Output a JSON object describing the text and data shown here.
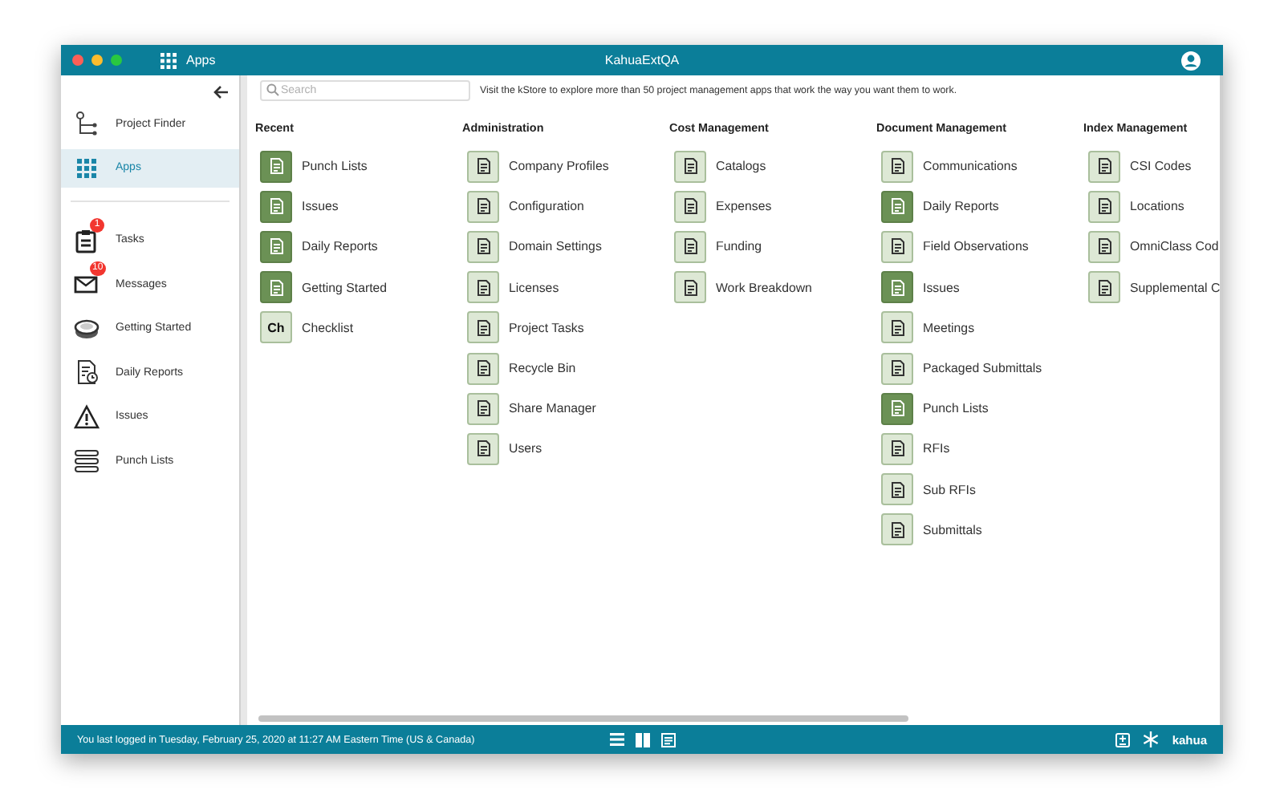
{
  "window": {
    "title": "KahuaExtQA",
    "app_label": "Apps"
  },
  "sidebar": {
    "items": [
      {
        "label": "Project Finder",
        "selected": false
      },
      {
        "label": "Apps",
        "selected": true
      },
      {
        "label": "Tasks",
        "selected": false,
        "badge": "1"
      },
      {
        "label": "Messages",
        "selected": false,
        "badge": "10"
      },
      {
        "label": "Getting Started",
        "selected": false
      },
      {
        "label": "Daily Reports",
        "selected": false
      },
      {
        "label": "Issues",
        "selected": false
      },
      {
        "label": "Punch Lists",
        "selected": false
      }
    ]
  },
  "search": {
    "placeholder": "Search"
  },
  "notice": "Visit the kStore to explore more than 50 project management apps that work the way you want them to work.",
  "groups": [
    {
      "title": "Recent",
      "apps": [
        {
          "label": "Punch Lists",
          "highlighted": true
        },
        {
          "label": "Issues",
          "highlighted": true
        },
        {
          "label": "Daily Reports",
          "highlighted": true
        },
        {
          "label": "Getting Started",
          "highlighted": true
        },
        {
          "label": "Checklist",
          "highlighted": false,
          "tile_text": "Ch"
        }
      ]
    },
    {
      "title": "Administration",
      "apps": [
        {
          "label": "Company Profiles",
          "highlighted": false
        },
        {
          "label": "Configuration",
          "highlighted": false
        },
        {
          "label": "Domain Settings",
          "highlighted": false
        },
        {
          "label": "Licenses",
          "highlighted": false
        },
        {
          "label": "Project Tasks",
          "highlighted": false
        },
        {
          "label": "Recycle Bin",
          "highlighted": false
        },
        {
          "label": "Share Manager",
          "highlighted": false
        },
        {
          "label": "Users",
          "highlighted": false
        }
      ]
    },
    {
      "title": "Cost Management",
      "apps": [
        {
          "label": "Catalogs",
          "highlighted": false
        },
        {
          "label": "Expenses",
          "highlighted": false
        },
        {
          "label": "Funding",
          "highlighted": false
        },
        {
          "label": "Work Breakdown",
          "highlighted": false
        }
      ]
    },
    {
      "title": "Document Management",
      "apps": [
        {
          "label": "Communications",
          "highlighted": false
        },
        {
          "label": "Daily Reports",
          "highlighted": true
        },
        {
          "label": "Field Observations",
          "highlighted": false
        },
        {
          "label": "Issues",
          "highlighted": true
        },
        {
          "label": "Meetings",
          "highlighted": false
        },
        {
          "label": "Packaged Submittals",
          "highlighted": false
        },
        {
          "label": "Punch Lists",
          "highlighted": true
        },
        {
          "label": "RFIs",
          "highlighted": false
        },
        {
          "label": "Sub RFIs",
          "highlighted": false
        },
        {
          "label": "Submittals",
          "highlighted": false
        }
      ]
    },
    {
      "title": "Index Management",
      "apps": [
        {
          "label": "CSI Codes",
          "highlighted": false
        },
        {
          "label": "Locations",
          "highlighted": false
        },
        {
          "label": "OmniClass Cod",
          "highlighted": false
        },
        {
          "label": "Supplemental C",
          "highlighted": false
        }
      ]
    }
  ],
  "status_bar": {
    "text": "You last logged in Tuesday, February 25, 2020 at 11:27 AM Eastern Time (US & Canada)",
    "brand": "kahua"
  }
}
